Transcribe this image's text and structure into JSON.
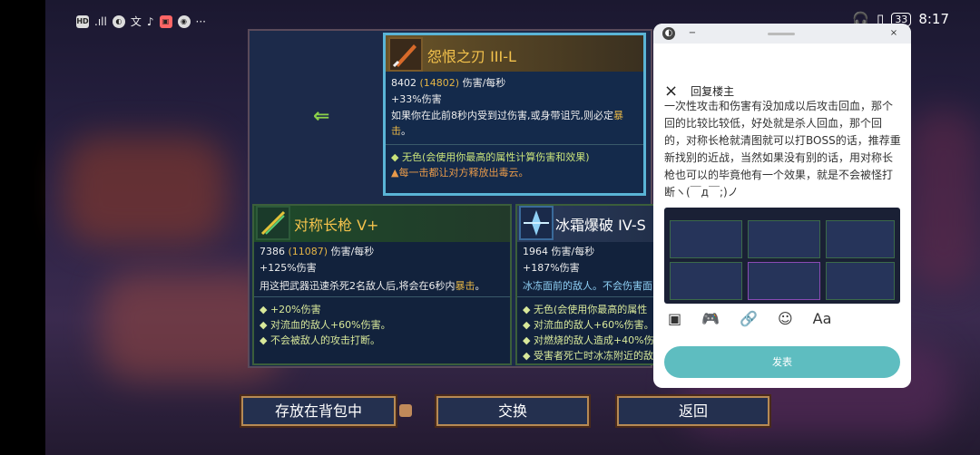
{
  "status_bar": {
    "left_text": "HD 5G",
    "app_icons": [
      "hd-icon",
      "signal-icon",
      "app-icon-1",
      "app-icon-2",
      "tiktok-icon",
      "app-icon-3",
      "app-icon-4",
      "more-icon"
    ],
    "battery": "33",
    "time": "8:17"
  },
  "inventory": {
    "back_arrow_label": "⇐",
    "selected_item": {
      "name": "怨恨之刃 III-L",
      "dps": "8402",
      "dps_bonus": "(14802)",
      "dps_unit": "伤害/每秒",
      "damage_bonus": "+33%伤害",
      "description_pre": "如果你在此前8秒内受到过伤害,或身带诅咒,则必定",
      "description_hl": "暴击",
      "description_post": "。",
      "bullets": [
        "无色(会使用你最高的属性计算伤害和效果)",
        "每一击都让对方释放出毒云。"
      ]
    },
    "item_left": {
      "name": "对称长枪  V+",
      "dps": "7386",
      "dps_bonus": "(11087)",
      "dps_unit": "伤害/每秒",
      "damage_bonus": "+125%伤害",
      "description_pre": "用这把武器迅速杀死2名敌人后,将会在6秒内",
      "description_hl": "暴击",
      "description_post": "。",
      "bullets": [
        "+20%伤害",
        "对流血的敌人+60%伤害。",
        "不会被敌人的攻击打断。"
      ]
    },
    "item_right": {
      "name": "冰霜爆破  IV-S",
      "dps": "1964",
      "dps_unit": "伤害/每秒",
      "damage_bonus": "+187%伤害",
      "description": "冰冻面前的敌人。不会伤害面",
      "bullets": [
        "无色(会使用你最高的属性",
        "对流血的敌人+60%伤害。",
        "对燃烧的敌人造成+40%伤",
        "受害者死亡时冰冻附近的敌"
      ]
    }
  },
  "buttons": {
    "store": "存放在背包中",
    "swap": "交换",
    "back": "返回"
  },
  "reply_dialog": {
    "close_x": "×",
    "title": "回复楼主",
    "body": "一次性攻击和伤害有没加成以后攻击回血，那个回的比较比较低，好处就是杀人回血，那个回的，对称长枪就清图就可以打BOSS的话，推荐重新找别的近战，当然如果没有别的话，用对称长枪也可以的毕竟他有一个效果，就是不会被怪打断ヽ(￣д￣;)ノ",
    "toolbar_icons": [
      "image-icon",
      "gamepad-icon",
      "link-icon",
      "emoji-icon",
      "text-format-icon"
    ],
    "toolbar_glyphs": [
      "▣",
      "🎮",
      "🔗",
      "☺",
      "Aa"
    ],
    "send_label": "发表"
  }
}
